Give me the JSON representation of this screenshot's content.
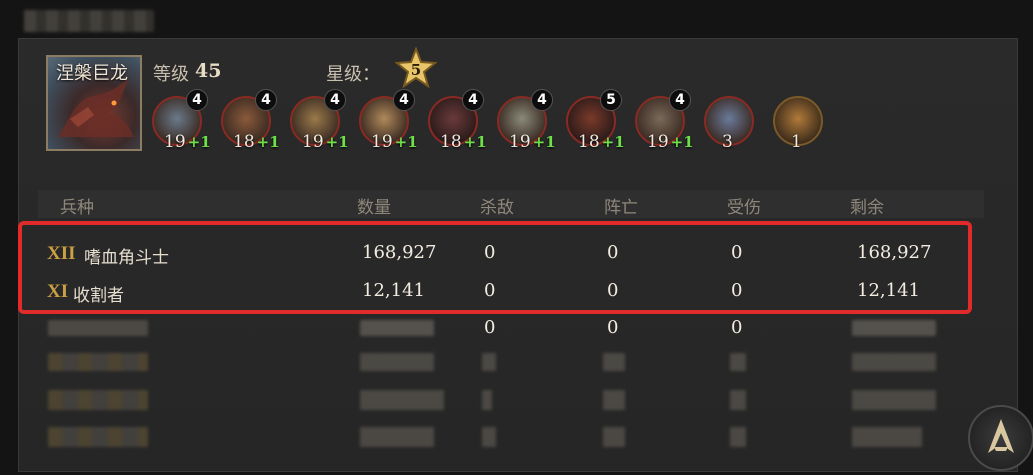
{
  "commander": {
    "name": "涅槃巨龙",
    "level_label": "等级",
    "level": "45",
    "star_label": "星级：",
    "stars": "5"
  },
  "units": [
    {
      "level": "4",
      "count": "19",
      "bonus": "+1",
      "ring": "#8a2a22"
    },
    {
      "level": "4",
      "count": "18",
      "bonus": "+1",
      "ring": "#8a2a22"
    },
    {
      "level": "4",
      "count": "19",
      "bonus": "+1",
      "ring": "#8a2a22"
    },
    {
      "level": "4",
      "count": "19",
      "bonus": "+1",
      "ring": "#8a2a22"
    },
    {
      "level": "4",
      "count": "18",
      "bonus": "+1",
      "ring": "#8a2a22"
    },
    {
      "level": "4",
      "count": "19",
      "bonus": "+1",
      "ring": "#8a2a22"
    },
    {
      "level": "5",
      "count": "18",
      "bonus": "+1",
      "ring": "#8a2a22"
    },
    {
      "level": "4",
      "count": "19",
      "bonus": "+1",
      "ring": "#8a2a22"
    },
    {
      "level": "",
      "count": "3",
      "bonus": "",
      "ring": "#8a2a22"
    },
    {
      "level": "",
      "count": "1",
      "bonus": "",
      "ring": "#7a5a2a"
    }
  ],
  "table": {
    "headers": [
      "兵种",
      "数量",
      "杀敌",
      "阵亡",
      "受伤",
      "剩余"
    ],
    "rows": [
      {
        "tier": "XII",
        "name": "嗜血角斗士",
        "quantity": "168,927",
        "kills": "0",
        "dead": "0",
        "wounded": "0",
        "remaining": "168,927"
      },
      {
        "tier": "XI",
        "name": "收割者",
        "quantity": "12,141",
        "kills": "0",
        "dead": "0",
        "wounded": "0",
        "remaining": "12,141"
      },
      {
        "tier": "",
        "name": "",
        "quantity": "",
        "kills": "0",
        "dead": "0",
        "wounded": "0",
        "remaining": ""
      }
    ]
  },
  "colors": {
    "highlight": "#e12a2a",
    "tier_gold": "#caa043",
    "bonus_green": "#6fe04a"
  }
}
